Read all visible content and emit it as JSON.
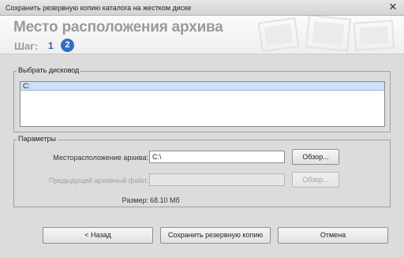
{
  "window": {
    "title": "Сохранить резервную копию каталога на жестком диске"
  },
  "header": {
    "title": "Место расположения архива",
    "step_label": "Шаг:",
    "step_1": "1",
    "step_2": "2"
  },
  "drive_group": {
    "legend": "Выбрать дисковод",
    "drives": [
      "C:"
    ]
  },
  "params_group": {
    "legend": "Параметры",
    "location_label": "Месторасположение архива:",
    "location_value": "C:\\",
    "browse_label": "Обзор...",
    "prev_file_label": "Предыдущий архивный файл:",
    "prev_file_value": "",
    "prev_browse_label": "Обзор...",
    "size_label": "Размер:",
    "size_value": "68.10 Мб"
  },
  "footer": {
    "back_label": "< Назад",
    "save_label": "Сохранить резервную копию",
    "cancel_label": "Отмена"
  },
  "colors": {
    "accent": "#2f6fc4",
    "selection": "#cde0f6"
  }
}
